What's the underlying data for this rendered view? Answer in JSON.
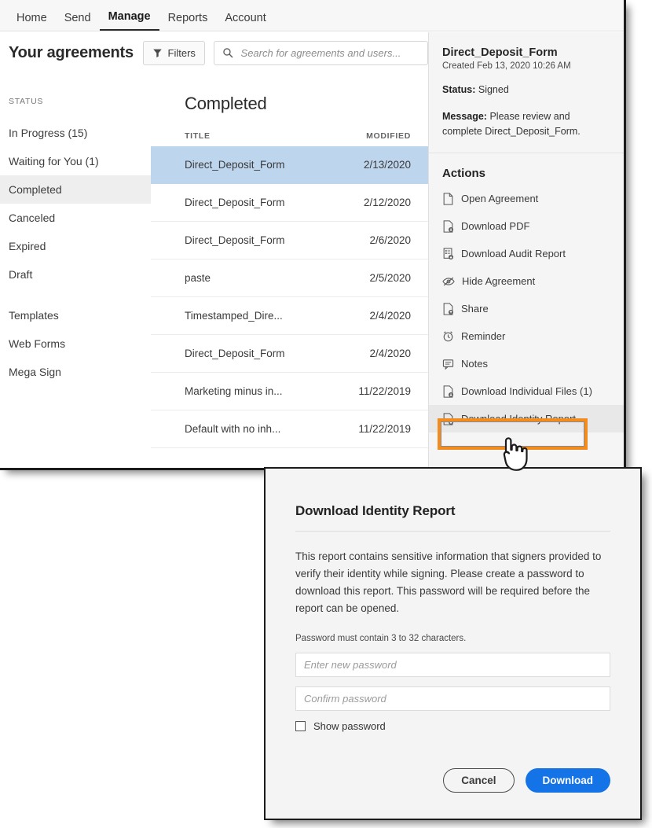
{
  "nav": {
    "items": [
      {
        "label": "Home",
        "active": false
      },
      {
        "label": "Send",
        "active": false
      },
      {
        "label": "Manage",
        "active": true
      },
      {
        "label": "Reports",
        "active": false
      },
      {
        "label": "Account",
        "active": false
      }
    ]
  },
  "header": {
    "title": "Your agreements",
    "filters_label": "Filters",
    "filter_icon": "funnel-icon",
    "search_icon": "search-icon",
    "search_placeholder": "Search for agreements and users...",
    "search_value": ""
  },
  "sidebar": {
    "section_label": "STATUS",
    "items": [
      {
        "label": "In Progress (15)",
        "selected": false
      },
      {
        "label": "Waiting for You (1)",
        "selected": false
      },
      {
        "label": "Completed",
        "selected": true
      },
      {
        "label": "Canceled",
        "selected": false
      },
      {
        "label": "Expired",
        "selected": false
      },
      {
        "label": "Draft",
        "selected": false
      }
    ],
    "extra_items": [
      {
        "label": "Templates"
      },
      {
        "label": "Web Forms"
      },
      {
        "label": "Mega Sign"
      }
    ]
  },
  "list": {
    "title": "Completed",
    "columns": {
      "title": "TITLE",
      "modified": "MODIFIED"
    },
    "rows": [
      {
        "title": "Direct_Deposit_Form",
        "modified": "2/13/2020",
        "selected": true
      },
      {
        "title": "Direct_Deposit_Form",
        "modified": "2/12/2020",
        "selected": false
      },
      {
        "title": "Direct_Deposit_Form",
        "modified": "2/6/2020",
        "selected": false
      },
      {
        "title": "paste",
        "modified": "2/5/2020",
        "selected": false
      },
      {
        "title": "Timestamped_Dire...",
        "modified": "2/4/2020",
        "selected": false
      },
      {
        "title": "Direct_Deposit_Form",
        "modified": "2/4/2020",
        "selected": false
      },
      {
        "title": "Marketing minus in...",
        "modified": "11/22/2019",
        "selected": false
      },
      {
        "title": "Default with no inh...",
        "modified": "11/22/2019",
        "selected": false
      }
    ]
  },
  "detail": {
    "title": "Direct_Deposit_Form",
    "created": "Created Feb 13, 2020 10:26 AM",
    "status_label": "Status:",
    "status_value": "Signed",
    "message_label": "Message:",
    "message_value": "Please review and complete Direct_Deposit_Form.",
    "actions_title": "Actions",
    "actions": [
      {
        "label": "Open Agreement",
        "icon": "document-icon",
        "highlighted": false
      },
      {
        "label": "Download PDF",
        "icon": "pdf-download-icon",
        "highlighted": false
      },
      {
        "label": "Download Audit Report",
        "icon": "audit-download-icon",
        "highlighted": false
      },
      {
        "label": "Hide Agreement",
        "icon": "eye-slash-icon",
        "highlighted": false
      },
      {
        "label": "Share",
        "icon": "share-document-icon",
        "highlighted": false
      },
      {
        "label": "Reminder",
        "icon": "alarm-clock-icon",
        "highlighted": false
      },
      {
        "label": "Notes",
        "icon": "note-icon",
        "highlighted": false
      },
      {
        "label": "Download Individual Files (1)",
        "icon": "file-download-icon",
        "highlighted": false
      },
      {
        "label": "Download Identity Report",
        "icon": "file-download-icon",
        "highlighted": true
      }
    ]
  },
  "callout": {
    "accent_color": "#f28c1e",
    "target_label": "Download Identity Report",
    "cursor_icon": "pointing-hand-cursor"
  },
  "dialog": {
    "title": "Download Identity Report",
    "body": "This report contains sensitive information that signers provided to verify their identity while signing. Please create a password to download this report. This password will be required before the report can be opened.",
    "hint": "Password must contain 3 to 32 characters.",
    "password_placeholder": "Enter new password",
    "password_value": "",
    "confirm_placeholder": "Confirm password",
    "confirm_value": "",
    "show_password_label": "Show password",
    "show_password_checked": false,
    "cancel_label": "Cancel",
    "download_label": "Download",
    "download_color": "#1473e6"
  }
}
